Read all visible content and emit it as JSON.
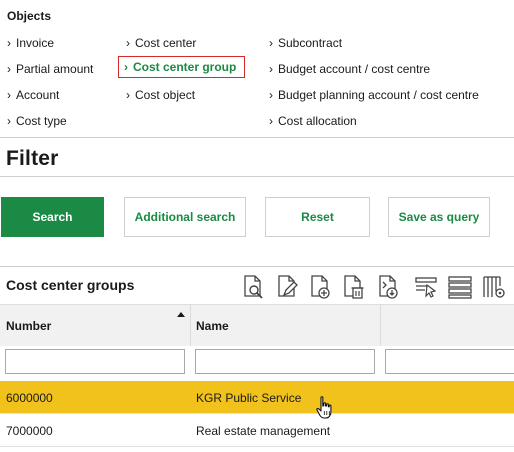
{
  "objects": {
    "title": "Objects",
    "links": [
      {
        "label": "Invoice",
        "active": false
      },
      {
        "label": "Partial amount",
        "active": false
      },
      {
        "label": "Account",
        "active": false
      },
      {
        "label": "Cost type",
        "active": false
      },
      {
        "label": "Cost center",
        "active": false
      },
      {
        "label": "Cost center group",
        "active": true
      },
      {
        "label": "Cost object",
        "active": false
      },
      {
        "label": "Subcontract",
        "active": false
      },
      {
        "label": "Budget account / cost centre",
        "active": false
      },
      {
        "label": "Budget planning account / cost centre",
        "active": false
      },
      {
        "label": "Cost allocation",
        "active": false
      }
    ]
  },
  "filter": {
    "title": "Filter",
    "buttons": {
      "search": "Search",
      "additional_search": "Additional search",
      "reset": "Reset",
      "save_as_query": "Save as query"
    }
  },
  "grid": {
    "title": "Cost center groups",
    "toolbar_icons": [
      "view-document-icon",
      "edit-document-icon",
      "add-document-icon",
      "delete-document-icon",
      "export-document-icon",
      "filter-rows-icon",
      "list-view-icon",
      "column-settings-icon"
    ],
    "columns": [
      {
        "label": "Number",
        "sort": "ascending"
      },
      {
        "label": "Name",
        "sort": ""
      }
    ],
    "filters": {
      "number": "",
      "name": "",
      "extra": ""
    },
    "rows": [
      {
        "number": "6000000",
        "name": "KGR Public Service",
        "selected": true
      },
      {
        "number": "7000000",
        "name": "Real estate management",
        "selected": false
      }
    ]
  },
  "colors": {
    "accent": "#1b8a44",
    "selected_row": "#f1c21b",
    "active_outline": "#d42a2a"
  }
}
